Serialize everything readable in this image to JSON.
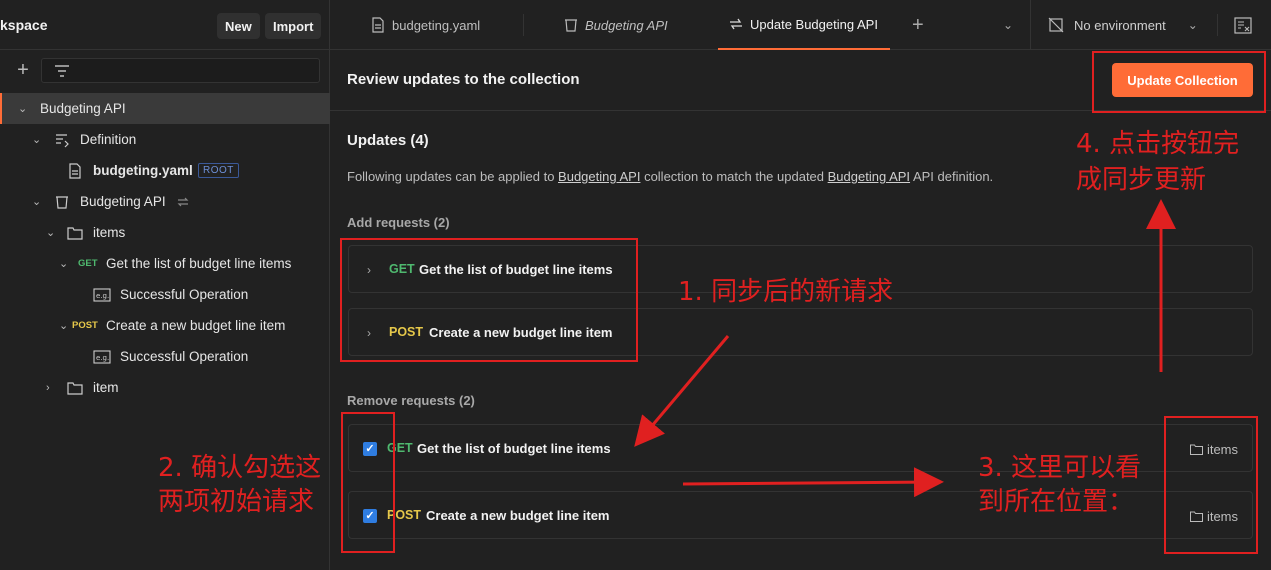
{
  "workspace": {
    "title": "kspace",
    "new_label": "New",
    "import_label": "Import"
  },
  "tree": {
    "root": "Budgeting API",
    "definition": "Definition",
    "file": "budgeting.yaml",
    "root_badge": "ROOT",
    "collection": "Budgeting API",
    "folder_items": "items",
    "get_method": "GET",
    "get_name": "Get the list of budget line items",
    "example_1": "Successful Operation",
    "post_method": "POST",
    "post_name": "Create a new budget line item",
    "example_2": "Successful Operation",
    "folder_item": "item"
  },
  "tabs": [
    {
      "label": "budgeting.yaml"
    },
    {
      "label": "Budgeting API"
    },
    {
      "label": "Update Budgeting API"
    }
  ],
  "environment": "No environment",
  "main": {
    "title": "Review updates to the collection",
    "update_button": "Update Collection",
    "updates_title": "Updates (4)",
    "desc_prefix": "Following updates can be applied to ",
    "desc_link1": "Budgeting API",
    "desc_mid": " collection to match the updated ",
    "desc_link2": "Budgeting API",
    "desc_suffix": " API definition.",
    "add_label": "Add requests (2)",
    "remove_label": "Remove requests (2)",
    "add_requests": [
      {
        "method": "GET",
        "name": "Get the list of budget line items"
      },
      {
        "method": "POST",
        "name": "Create a new budget line item"
      }
    ],
    "remove_requests": [
      {
        "method": "GET",
        "name": "Get the list of budget line items",
        "location": "items"
      },
      {
        "method": "POST",
        "name": "Create a new budget line item",
        "location": "items"
      }
    ]
  },
  "annotations": {
    "a1": "1. 同步后的新请求",
    "a2_line1": "2. 确认勾选这",
    "a2_line2": "两项初始请求",
    "a3_line1": "3. 这里可以看",
    "a3_line2": "到所在位置：",
    "a4_line1": "4. 点击按钮完",
    "a4_line2": "成同步更新"
  },
  "colors": {
    "accent": "#ff6c37",
    "get": "#4fb96f",
    "post": "#e6c84a",
    "annotation": "#e02020"
  }
}
